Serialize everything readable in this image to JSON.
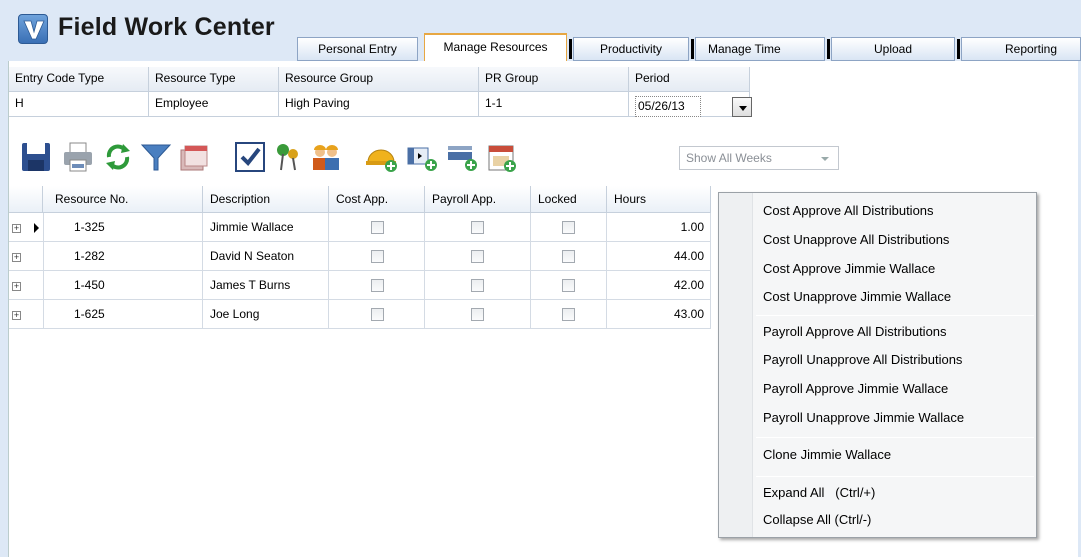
{
  "app": {
    "title": "Field Work Center"
  },
  "tabs": [
    {
      "label": "Personal Entry",
      "active": false
    },
    {
      "label": "Manage Resources",
      "active": true
    },
    {
      "label": "Productivity",
      "active": false
    },
    {
      "label": "Manage Time",
      "active": false
    },
    {
      "label": "Upload",
      "active": false
    },
    {
      "label": "Reporting",
      "active": false
    }
  ],
  "filters": {
    "headers": [
      "Entry Code Type",
      "Resource Type",
      "Resource Group",
      "PR Group",
      "Period"
    ],
    "values": [
      "H",
      "Employee",
      "High Paving",
      "1-1",
      "05/26/13"
    ]
  },
  "toolbar": {
    "icons": [
      "save-icon",
      "print-icon",
      "refresh-icon",
      "filter-icon",
      "calendar-pages-icon",
      "checkbox-icon",
      "pushpin-icon",
      "workers-icon",
      "add-hardhat-icon",
      "add-column-icon",
      "add-row-icon",
      "calendar-add-icon"
    ],
    "weeks_select": "Show All Weeks"
  },
  "table": {
    "columns": [
      "Resource No.",
      "Description",
      "Cost App.",
      "Payroll App.",
      "Locked",
      "Hours"
    ],
    "rows": [
      {
        "resource_no": "1-325",
        "description": "Jimmie Wallace",
        "cost_app": false,
        "payroll_app": false,
        "locked": false,
        "hours": "1.00",
        "selected": true
      },
      {
        "resource_no": "1-282",
        "description": "David N Seaton",
        "cost_app": false,
        "payroll_app": false,
        "locked": false,
        "hours": "44.00",
        "selected": false
      },
      {
        "resource_no": "1-450",
        "description": "James T Burns",
        "cost_app": false,
        "payroll_app": false,
        "locked": false,
        "hours": "42.00",
        "selected": false
      },
      {
        "resource_no": "1-625",
        "description": "Joe Long",
        "cost_app": false,
        "payroll_app": false,
        "locked": false,
        "hours": "43.00",
        "selected": false
      }
    ]
  },
  "context_menu": {
    "groups": [
      [
        "Cost Approve All Distributions",
        "Cost Unapprove All Distributions",
        "Cost Approve Jimmie Wallace",
        "Cost Unapprove Jimmie Wallace"
      ],
      [
        "Payroll Approve All Distributions",
        "Payroll Unapprove All Distributions",
        "Payroll Approve Jimmie Wallace",
        "Payroll Unapprove Jimmie Wallace"
      ],
      [
        "Clone Jimmie Wallace"
      ],
      [
        "Expand All   (Ctrl/+)",
        "Collapse All (Ctrl/-)"
      ]
    ]
  },
  "colors": {
    "background": "#dde8f6",
    "active_tab_border": "#e7a743",
    "grid_line": "#c6d0dc"
  }
}
